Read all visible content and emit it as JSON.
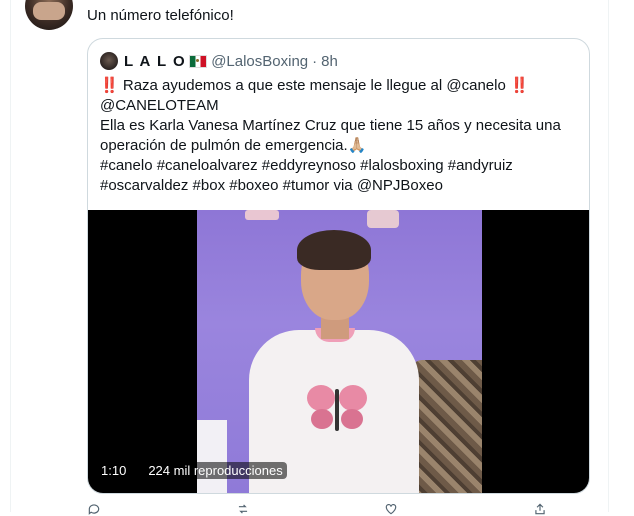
{
  "reply": {
    "text": "Un número telefónico!"
  },
  "quoted_tweet": {
    "name": "L A L O",
    "handle": "@LalosBoxing",
    "separator": "·",
    "time": "8h",
    "lines": [
      {
        "bang_left": "‼️",
        "text": " Raza ayudemos a que este mensaje le llegue al @canelo ",
        "bang_right": "‼️"
      },
      {
        "text": "@CANELOTEAM"
      },
      {
        "text": "Ella es Karla Vanesa Martínez Cruz que tiene 15 años y necesita una"
      },
      {
        "text": "operación de pulmón de emergencia.🙏🏼"
      },
      {
        "text": "#canelo #caneloalvarez #eddyreynoso #lalosboxing #andyruiz"
      },
      {
        "text": "#oscarvaldez #box #boxeo #tumor via @NPJBoxeo"
      }
    ],
    "video": {
      "duration": "1:10",
      "views": "224 mil reproducciones"
    }
  },
  "colors": {
    "text": "#0f1419",
    "secondary": "#536471",
    "border": "#cfd9de",
    "emphasis": "#e0245e"
  },
  "icons": [
    "reply-icon",
    "retweet-icon",
    "like-icon",
    "share-icon"
  ]
}
